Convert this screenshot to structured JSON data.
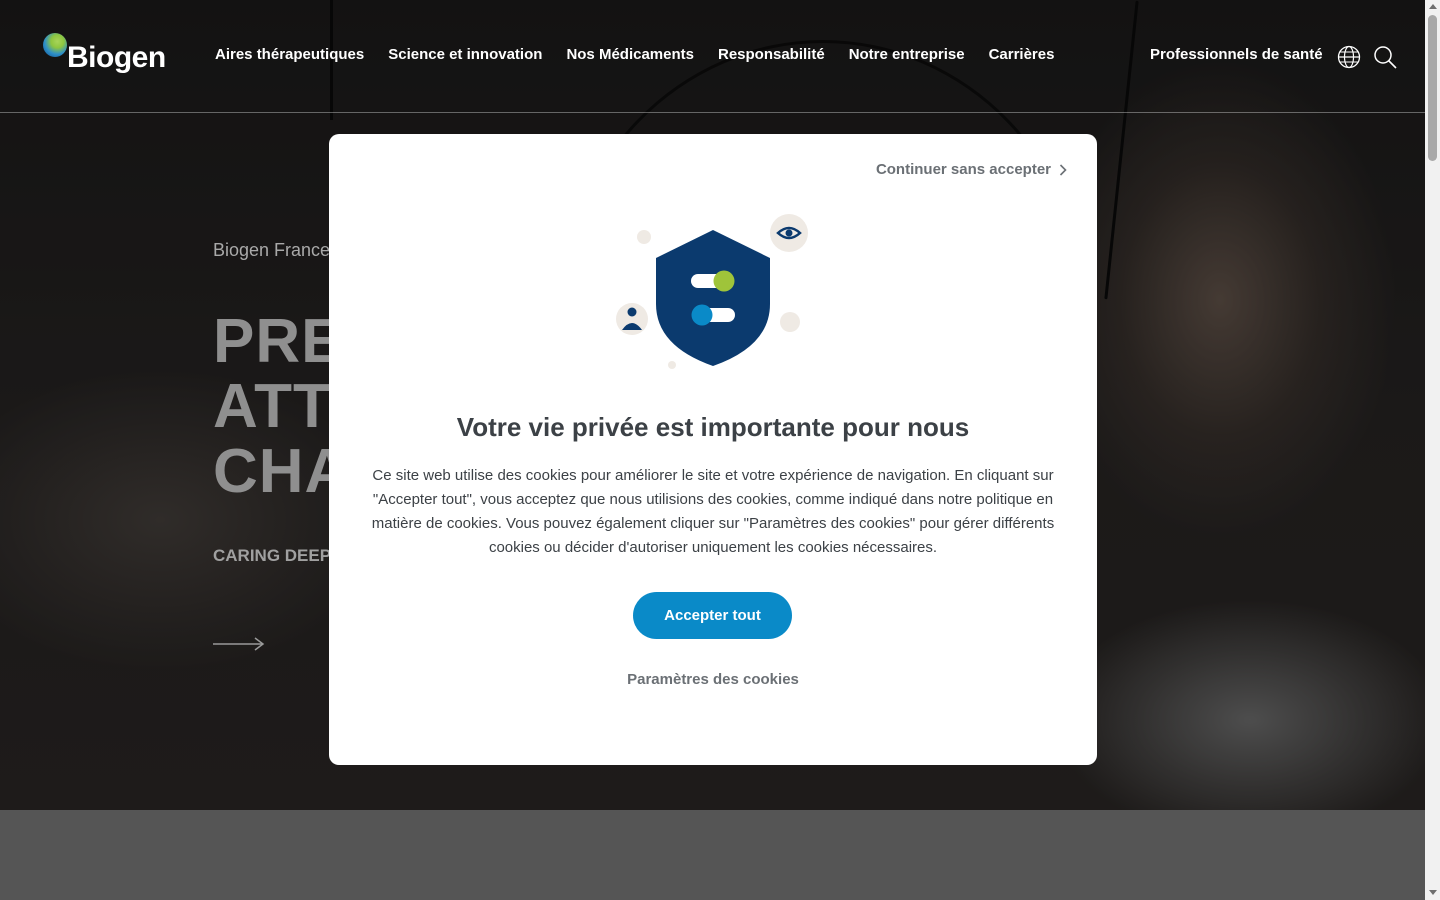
{
  "header": {
    "logo_text": "Biogen",
    "nav": [
      {
        "label": "Aires thérapeutiques"
      },
      {
        "label": "Science et innovation"
      },
      {
        "label": "Nos Médicaments"
      },
      {
        "label": "Responsabilité"
      },
      {
        "label": "Notre entreprise"
      },
      {
        "label": "Carrières"
      }
    ],
    "hcp_link": "Professionnels de santé",
    "icons": [
      "globe-icon",
      "search-icon"
    ]
  },
  "hero": {
    "kicker": "Biogen France",
    "title_lines": [
      "PREN",
      "ATTE",
      "CHAI"
    ],
    "subtitle": "CARING DEEPL",
    "arrow_icon": "arrow-right-icon"
  },
  "cookie_modal": {
    "continue_link": "Continuer sans accepter",
    "title": "Votre vie privée est importante pour nous",
    "body": "Ce site web utilise des cookies pour améliorer le site et votre expérience de navigation. En cliquant sur \"Accepter tout\", vous acceptez que nous utilisions des cookies, comme indiqué dans notre politique en matière de cookies. Vous pouvez également cliquer sur \"Paramètres des cookies\" pour gérer différents cookies ou décider d'autoriser uniquement les cookies nécessaires.",
    "accept_label": "Accepter tout",
    "settings_label": "Paramètres des cookies",
    "colors": {
      "accent": "#0a8ac8",
      "shield": "#0b3a6e",
      "green": "#9fc43a"
    }
  }
}
